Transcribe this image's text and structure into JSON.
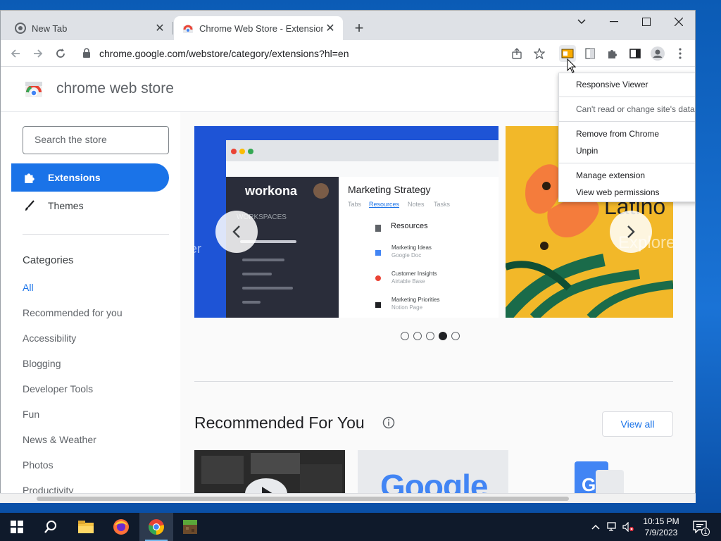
{
  "browser": {
    "tabs": [
      {
        "label": "New Tab",
        "active": false
      },
      {
        "label": "Chrome Web Store - Extensions",
        "active": true
      }
    ],
    "url": "chrome.google.com/webstore/category/extensions?hl=en"
  },
  "store": {
    "title": "chrome web store",
    "search_placeholder": "Search the store",
    "nav": [
      {
        "label": "Extensions",
        "icon": "puzzle-icon",
        "active": true
      },
      {
        "label": "Themes",
        "icon": "brush-icon",
        "active": false
      }
    ],
    "categories_heading": "Categories",
    "categories": [
      {
        "label": "All",
        "selected": true
      },
      {
        "label": "Recommended for you"
      },
      {
        "label": "Accessibility"
      },
      {
        "label": "Blogging"
      },
      {
        "label": "Developer Tools"
      },
      {
        "label": "Fun"
      },
      {
        "label": "News & Weather"
      },
      {
        "label": "Photos"
      },
      {
        "label": "Productivity"
      }
    ]
  },
  "carousel": {
    "slide1": {
      "brand": "workona",
      "section": "WORKSPACES",
      "doc_title": "Marketing Strategy",
      "doc_tabs": [
        "Tabs",
        "Resources",
        "Notes",
        "Tasks"
      ],
      "resources_heading": "Resources",
      "resources": [
        {
          "title": "Marketing Ideas",
          "sub": "Google Doc"
        },
        {
          "title": "Customer Insights",
          "sub": "Airtable Base"
        },
        {
          "title": "Marketing Priorities",
          "sub": "Notion Page"
        }
      ],
      "edge_text": "er"
    },
    "slide2": {
      "line1": "Latino",
      "line2": "Explore"
    },
    "dot_count": 5,
    "active_dot": 4
  },
  "recommended": {
    "title": "Recommended For You",
    "view_all": "View all",
    "tile2_text": "Google"
  },
  "context_menu": {
    "items": [
      {
        "label": "Responsive Viewer",
        "dim": false
      },
      {
        "label": "Can't read or change site's data",
        "dim": true
      },
      {
        "label": "Remove from Chrome",
        "dim": false
      },
      {
        "label": "Unpin",
        "dim": false
      },
      {
        "label": "Manage extension",
        "dim": false
      },
      {
        "label": "View web permissions",
        "dim": false
      }
    ]
  },
  "taskbar": {
    "time": "10:15 PM",
    "date": "7/9/2023",
    "notification_count": "1"
  },
  "colors": {
    "accent": "#1a73e8",
    "taskbar": "#0f1a2b",
    "slide1_bg": "#1e54d6",
    "slide2_bg": "#f2b829"
  }
}
